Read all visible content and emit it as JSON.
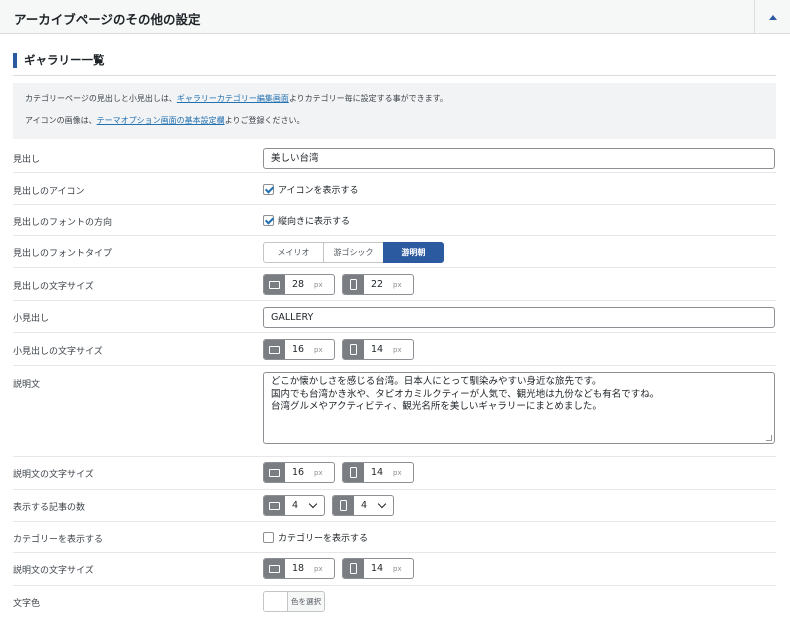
{
  "header": {
    "title": "アーカイブページのその他の設定"
  },
  "section": {
    "title": "ギャラリー一覧"
  },
  "description": {
    "line1_pre": "カテゴリーページの見出しと小見出しは、",
    "line1_link": "ギャラリーカテゴリー編集画面",
    "line1_post": "よりカテゴリー毎に設定する事ができます。",
    "line2_pre": "アイコンの画像は、",
    "line2_link": "テーマオプション画面の基本設定欄",
    "line2_post": "よりご登録ください。"
  },
  "fields": {
    "heading": {
      "label": "見出し",
      "value": "美しい台湾"
    },
    "heading_icon": {
      "label": "見出しのアイコン",
      "checkbox_label": "アイコンを表示する",
      "checked": true
    },
    "heading_direction": {
      "label": "見出しのフォントの方向",
      "checkbox_label": "縦向きに表示する",
      "checked": true
    },
    "heading_font_type": {
      "label": "見出しのフォントタイプ",
      "options": [
        "メイリオ",
        "游ゴシック",
        "游明朝"
      ],
      "selected": "游明朝"
    },
    "heading_size": {
      "label": "見出しの文字サイズ",
      "pc": "28",
      "sp": "22",
      "unit": "px"
    },
    "subheading": {
      "label": "小見出し",
      "value": "GALLERY"
    },
    "subheading_size": {
      "label": "小見出しの文字サイズ",
      "pc": "16",
      "sp": "14",
      "unit": "px"
    },
    "desc_text": {
      "label": "説明文",
      "lines": [
        "どこか懐かしさを感じる台湾。日本人にとって馴染みやすい身近な旅先です。",
        "国内でも台湾かき氷や、タピオカミルクティーが人気で、観光地は九份なども有名ですね。",
        "台湾グルメやアクティビティ、観光名所を美しいギャラリーにまとめました。"
      ]
    },
    "desc_size": {
      "label": "説明文の文字サイズ",
      "pc": "16",
      "sp": "14",
      "unit": "px"
    },
    "post_count": {
      "label": "表示する記事の数",
      "pc": "4",
      "sp": "4"
    },
    "show_category": {
      "label": "カテゴリーを表示する",
      "checkbox_label": "カテゴリーを表示する",
      "checked": false
    },
    "desc_size2": {
      "label": "説明文の文字サイズ",
      "pc": "18",
      "sp": "14",
      "unit": "px"
    },
    "text_color": {
      "label": "文字色",
      "button_label": "色を選択"
    }
  },
  "colors": {
    "accent": "#2c5aa0",
    "link": "#2271b1",
    "icon_bg": "#7a7d82"
  },
  "icons": {
    "pc": "monitor-icon",
    "sp": "phone-icon",
    "collapse": "triangle-up-icon"
  }
}
